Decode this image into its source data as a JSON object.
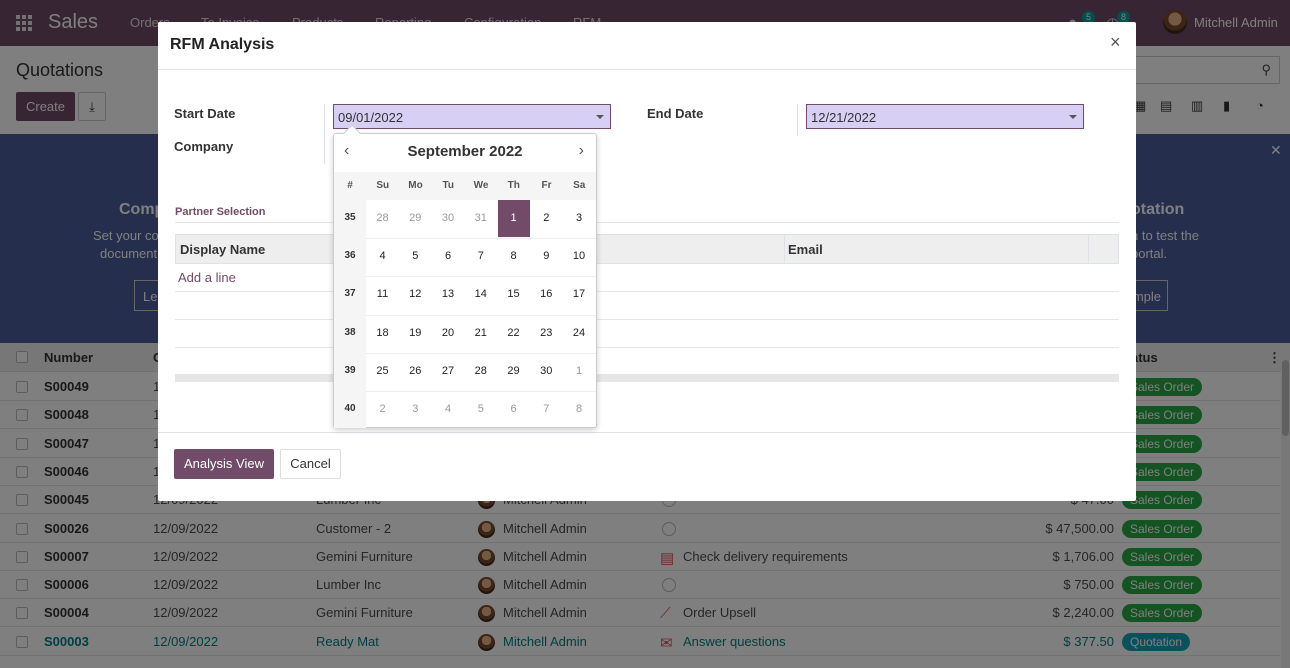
{
  "navbar": {
    "brand": "Sales",
    "menus": [
      "Orders",
      "To Invoice",
      "Products",
      "Reporting",
      "Configuration",
      "RFM"
    ],
    "messages_badge": "5",
    "activities_badge": "8",
    "user": "Mitchell Admin"
  },
  "control_panel": {
    "title": "Quotations",
    "create_label": "Create",
    "download_icon": "download-icon",
    "search_icon": "search-icon",
    "view_icons": [
      "kanban-icon",
      "calendar-icon",
      "pivot-icon",
      "graph-icon",
      "activity-icon"
    ]
  },
  "banner": {
    "left_title": "Comp",
    "left_line1": "Set your co",
    "left_line2": "document",
    "left_button": "Le",
    "right_title": "otation",
    "right_line1": "n to test the",
    "right_line2": "portal.",
    "right_button": "mple",
    "close_icon": "close-icon"
  },
  "list": {
    "headers": {
      "number": "Number",
      "date": "C",
      "status": "atus"
    },
    "rows": [
      {
        "number": "S00049",
        "date": "1",
        "customer": "",
        "salesperson": "",
        "activity": "",
        "total": "",
        "status": "Sales Order"
      },
      {
        "number": "S00048",
        "date": "1",
        "customer": "",
        "salesperson": "",
        "activity": "",
        "total": "",
        "status": "Sales Order"
      },
      {
        "number": "S00047",
        "date": "1",
        "customer": "",
        "salesperson": "",
        "activity": "",
        "total": "",
        "status": "Sales Order"
      },
      {
        "number": "S00046",
        "date": "1",
        "customer": "",
        "salesperson": "",
        "activity": "",
        "total": "",
        "status": "Sales Order"
      },
      {
        "number": "S00045",
        "date": "12/09/2022",
        "customer": "Lumber Inc",
        "salesperson": "Mitchell Admin",
        "activity": "",
        "total": "$ 47.00",
        "status": "Sales Order"
      },
      {
        "number": "S00026",
        "date": "12/09/2022",
        "customer": "Customer - 2",
        "salesperson": "Mitchell Admin",
        "activity": "",
        "total": "$ 47,500.00",
        "status": "Sales Order"
      },
      {
        "number": "S00007",
        "date": "12/09/2022",
        "customer": "Gemini Furniture",
        "salesperson": "Mitchell Admin",
        "activity": "Check delivery requirements",
        "total": "$ 1,706.00",
        "status": "Sales Order"
      },
      {
        "number": "S00006",
        "date": "12/09/2022",
        "customer": "Lumber Inc",
        "salesperson": "Mitchell Admin",
        "activity": "",
        "total": "$ 750.00",
        "status": "Sales Order"
      },
      {
        "number": "S00004",
        "date": "12/09/2022",
        "customer": "Gemini Furniture",
        "salesperson": "Mitchell Admin",
        "activity": "Order Upsell",
        "total": "$ 2,240.00",
        "status": "Sales Order"
      },
      {
        "number": "S00003",
        "date": "12/09/2022",
        "customer": "Ready Mat",
        "salesperson": "Mitchell Admin",
        "activity": "Answer questions",
        "total": "$ 377.50",
        "status": "Quotation"
      }
    ]
  },
  "modal": {
    "title": "RFM Analysis",
    "close": "×",
    "start_date_label": "Start Date",
    "start_date_value": "09/01/2022",
    "end_date_label": "End Date",
    "end_date_value": "12/21/2022",
    "company_label": "Company",
    "partner_section": "Partner Selection",
    "col_display_name": "Display Name",
    "col_email": "Email",
    "add_line": "Add a line",
    "primary_button": "Analysis View",
    "cancel_button": "Cancel"
  },
  "datepicker": {
    "title": "September 2022",
    "prev": "‹",
    "next": "›",
    "headers": [
      "#",
      "Su",
      "Mo",
      "Tu",
      "We",
      "Th",
      "Fr",
      "Sa"
    ],
    "weeks": [
      {
        "wk": "35",
        "days": [
          "28",
          "29",
          "30",
          "31",
          "1",
          "2",
          "3"
        ]
      },
      {
        "wk": "36",
        "days": [
          "4",
          "5",
          "6",
          "7",
          "8",
          "9",
          "10"
        ]
      },
      {
        "wk": "37",
        "days": [
          "11",
          "12",
          "13",
          "14",
          "15",
          "16",
          "17"
        ]
      },
      {
        "wk": "38",
        "days": [
          "18",
          "19",
          "20",
          "21",
          "22",
          "23",
          "24"
        ]
      },
      {
        "wk": "39",
        "days": [
          "25",
          "26",
          "27",
          "28",
          "29",
          "30",
          "1"
        ]
      },
      {
        "wk": "40",
        "days": [
          "2",
          "3",
          "4",
          "5",
          "6",
          "7",
          "8"
        ]
      }
    ],
    "selected": "1"
  }
}
